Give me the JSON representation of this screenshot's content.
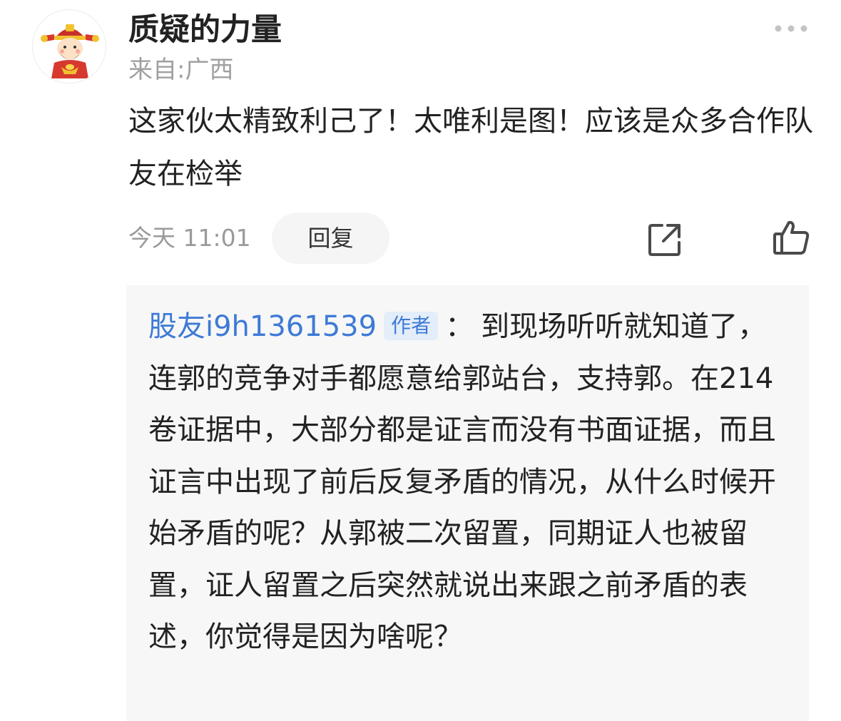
{
  "comment": {
    "username": "质疑的力量",
    "location": "来自:广西",
    "text": "这家伙太精致利己了！太唯利是图！应该是众多合作队友在检举",
    "time": "今天 11:01",
    "reply_label": "回复",
    "icons": {
      "avatar": "caishen-cartoon-avatar",
      "more": "more-dots-icon",
      "share": "share-icon",
      "like": "thumbs-up-icon"
    }
  },
  "reply": {
    "author": "股友i9h1361539",
    "badge": "作者",
    "colon": "：",
    "text": "到现场听听就知道了，连郭的竞争对手都愿意给郭站台，支持郭。在214卷证据中，大部分都是证言而没有书面证据，而且证言中出现了前后反复矛盾的情况，从什么时候开始矛盾的呢？从郭被二次留置，同期证人也被留置，证人留置之后突然就说出来跟之前矛盾的表述，你觉得是因为啥呢？"
  },
  "colors": {
    "author_link": "#3d7ad6",
    "badge_bg": "#e4edfa",
    "muted_text": "#9a9a9a",
    "reply_bg": "#f7f7f7"
  }
}
